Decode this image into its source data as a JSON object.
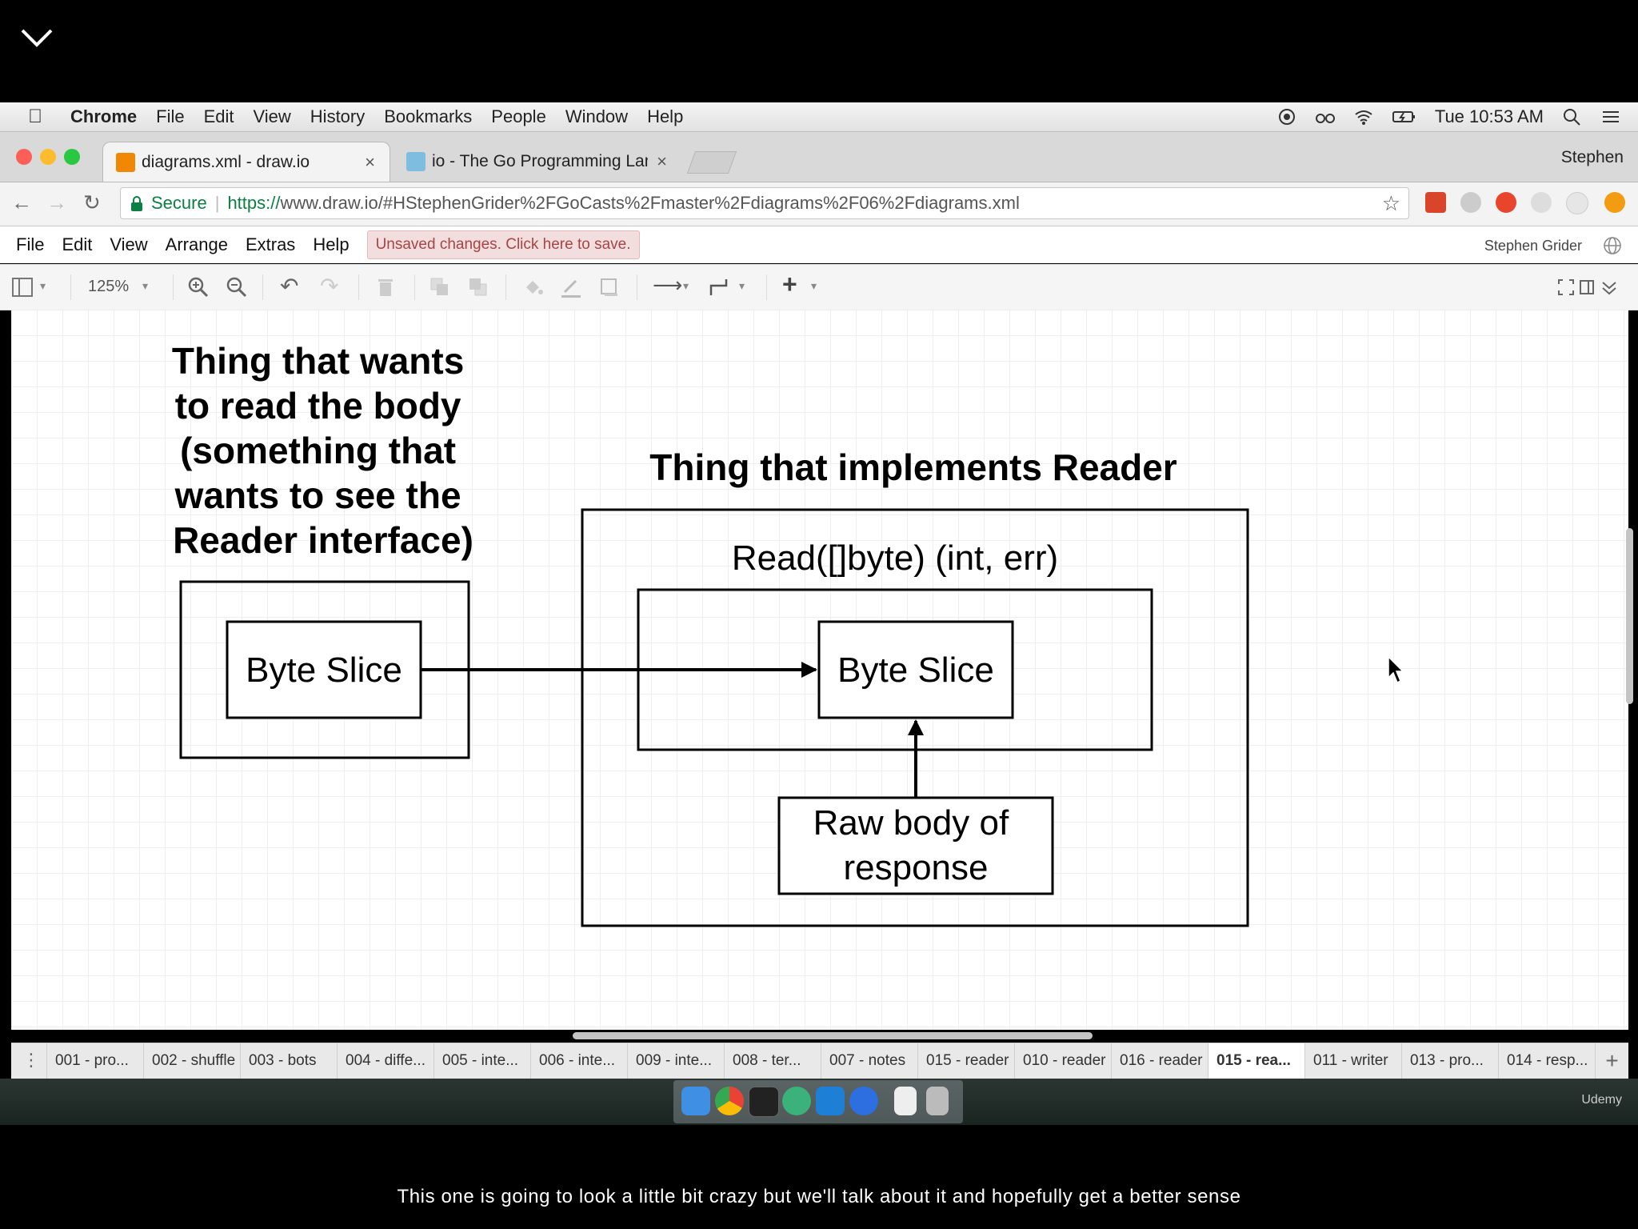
{
  "menubar": {
    "app": "Chrome",
    "items": [
      "File",
      "Edit",
      "View",
      "History",
      "Bookmarks",
      "People",
      "Window",
      "Help"
    ],
    "clock": "Tue 10:53 AM"
  },
  "browser": {
    "tabs": [
      {
        "title": "diagrams.xml - draw.io"
      },
      {
        "title": "io - The Go Programming Lang"
      }
    ],
    "profile": "Stephen",
    "secure_label": "Secure",
    "url_scheme": "https://",
    "url_rest": "www.draw.io/#HStephenGrider%2FGoCasts%2Fmaster%2Fdiagrams%2F06%2Fdiagrams.xml"
  },
  "drawio": {
    "menu": [
      "File",
      "Edit",
      "View",
      "Arrange",
      "Extras",
      "Help"
    ],
    "unsaved": "Unsaved changes. Click here to save.",
    "user": "Stephen Grider",
    "zoom": "125%"
  },
  "diagram": {
    "left_title": [
      "Thing that wants",
      "to read the body",
      "(something that",
      "wants to see the",
      "Reader interface)"
    ],
    "left_box_label": "Byte Slice",
    "right_title": "Thing that implements Reader",
    "method_signature": "Read([]byte) (int, err)",
    "inner_box_label": "Byte Slice",
    "raw_box_label": [
      "Raw body of",
      "response"
    ]
  },
  "pages": [
    "001 - pro...",
    "002 - shuffle",
    "003 - bots",
    "004 - diffe...",
    "005 - inte...",
    "006 - inte...",
    "009 - inte...",
    "008 - ter...",
    "007 - notes",
    "015 - reader",
    "010 - reader",
    "016 - reader",
    "015 - rea...",
    "011 - writer",
    "013 - pro...",
    "014 - resp..."
  ],
  "selected_page": "015 - rea...",
  "dock_watermark": "Udemy",
  "caption": "This one is going to look a little bit crazy but we'll talk about it and hopefully get a better sense"
}
